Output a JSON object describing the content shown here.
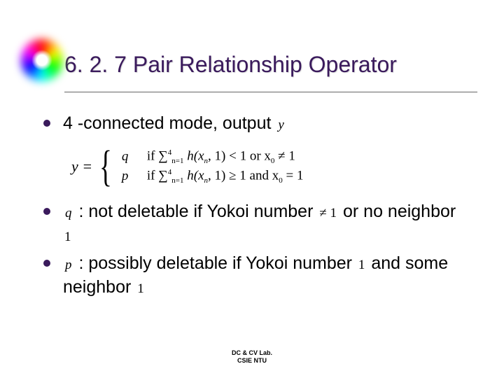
{
  "title": "6. 2. 7 Pair Relationship Operator",
  "bullets": {
    "b1": {
      "text": "4 -connected mode, output",
      "var": "y"
    },
    "b2": {
      "var": "q",
      "pre": " : not deletable if Yokoi number ",
      "cond": "≠ 1",
      "mid": " or no neighbor ",
      "tail": "1"
    },
    "b3": {
      "var": "p",
      "pre": " : possibly deletable if Yokoi number ",
      "cond": "1",
      "mid": " and some neighbor ",
      "tail": "1"
    }
  },
  "formula": {
    "lhs": "y =",
    "case1": {
      "val": "q",
      "cond": "if  ∑",
      "sub": "n=1",
      "sup": "4",
      "body": " h(x",
      "bodysub": "n",
      "body2": ", 1) < 1 or x",
      "body2sub": "0",
      "body3": " ≠ 1"
    },
    "case2": {
      "val": "p",
      "cond": "if  ∑",
      "sub": "n=1",
      "sup": "4",
      "body": " h(x",
      "bodysub": "n",
      "body2": ", 1) ≥ 1 and x",
      "body2sub": "0",
      "body3": " = 1"
    }
  },
  "footer": {
    "line1": "DC & CV Lab.",
    "line2": "CSIE NTU"
  }
}
